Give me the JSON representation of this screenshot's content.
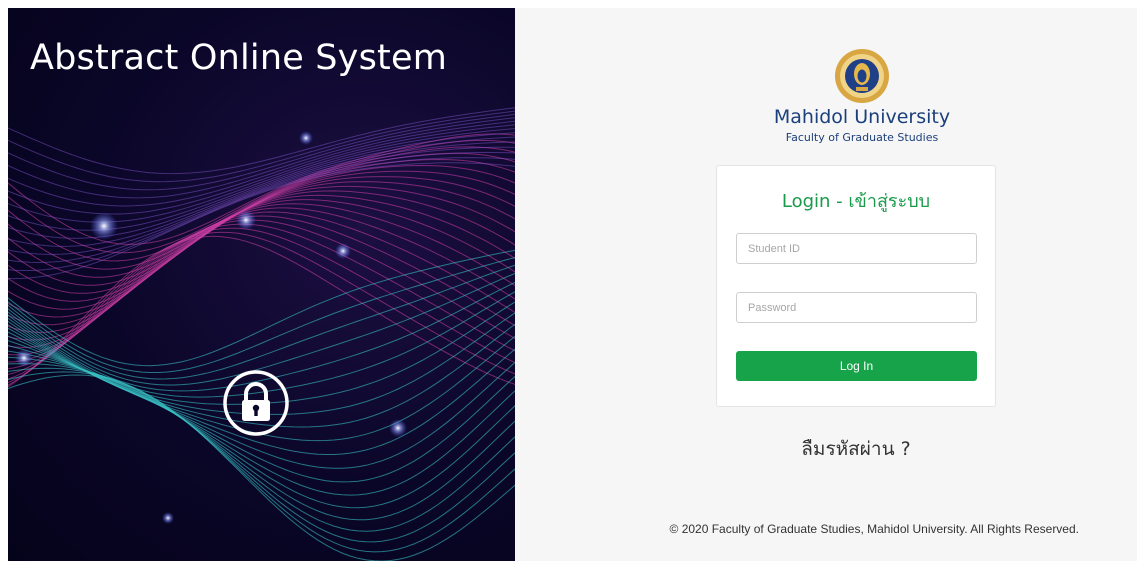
{
  "hero": {
    "title": "Abstract Online System",
    "lock_icon": "lock-icon"
  },
  "branding": {
    "crest_icon": "university-crest-icon",
    "university_name": "Mahidol University",
    "faculty_name": "Faculty of Graduate Studies"
  },
  "login": {
    "title": "Login - เข้าสู่ระบบ",
    "student_id": {
      "placeholder": "Student ID",
      "value": ""
    },
    "password": {
      "placeholder": "Password",
      "value": ""
    },
    "submit_label": "Log In"
  },
  "forgot_password": "ลืมรหัสผ่าน ?",
  "footer": "© 2020 Faculty of Graduate Studies, Mahidol University. All Rights Reserved.",
  "colors": {
    "accent_green": "#17a34a",
    "brand_blue": "#1b3f7a",
    "hero_background": "#0a0628"
  }
}
